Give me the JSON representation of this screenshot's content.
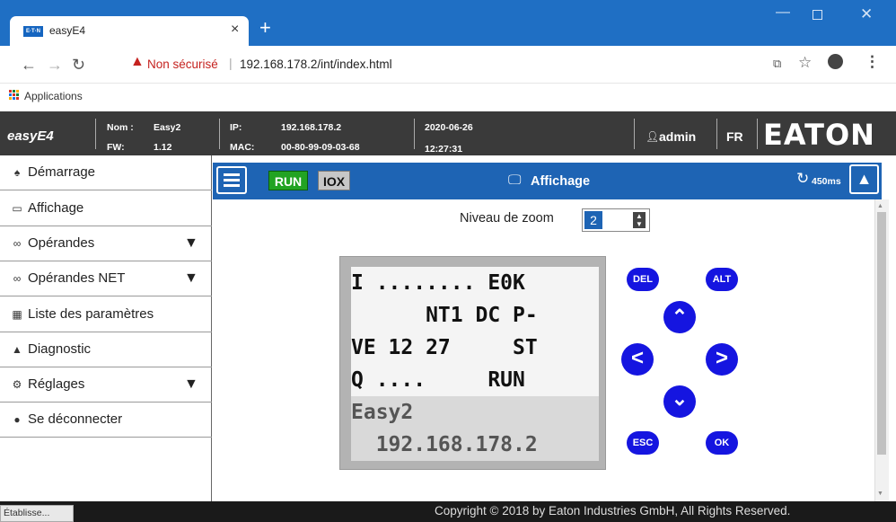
{
  "browser": {
    "tab_title": "easyE4",
    "tab_favicon_text": "E·T·N",
    "tab_close": "×",
    "new_tab": "+",
    "security_label": "Non sécurisé",
    "url": "192.168.178.2/int/index.html",
    "bookmark_apps": "Applications",
    "status_text": "Établisse..."
  },
  "header": {
    "product": "easyE4",
    "name_label": "Nom :",
    "name_value": "Easy2",
    "fw_label": "FW:",
    "fw_value": "1.12",
    "ip_label": "IP:",
    "ip_value": "192.168.178.2",
    "mac_label": "MAC:",
    "mac_value": "00-80-99-09-03-68",
    "date": "2020-06-26",
    "time": "12:27:31",
    "user": "admin",
    "lang": "FR",
    "brand": "EATON"
  },
  "sidebar": {
    "items": [
      {
        "label": "Démarrage",
        "icon": "home-icon",
        "expandable": false
      },
      {
        "label": "Affichage",
        "icon": "monitor-icon",
        "expandable": false
      },
      {
        "label": "Opérandes",
        "icon": "link-icon",
        "expandable": true
      },
      {
        "label": "Opérandes NET",
        "icon": "link-icon",
        "expandable": true
      },
      {
        "label": "Liste des paramètres",
        "icon": "list-icon",
        "expandable": false
      },
      {
        "label": "Diagnostic",
        "icon": "warning-icon",
        "expandable": false
      },
      {
        "label": "Réglages",
        "icon": "gear-icon",
        "expandable": true
      },
      {
        "label": "Se déconnecter",
        "icon": "user-icon",
        "expandable": false
      }
    ]
  },
  "toolbar": {
    "run_label": "RUN",
    "iox_label": "IOX",
    "title": "Affichage",
    "refresh_label": "450ms"
  },
  "zoom": {
    "label": "Niveau de zoom",
    "value": "2"
  },
  "lcd": {
    "row1": "I ........ E0K",
    "row2": "      NT1 DC P-",
    "row3": "VE 12 27     ST",
    "row4": "Q ....     RUN",
    "row5": "Easy2",
    "row6": "  192.168.178.2"
  },
  "keys": {
    "del": "DEL",
    "alt": "ALT",
    "esc": "ESC",
    "ok": "OK"
  },
  "footer": {
    "copyright": "Copyright © 2018 by Eaton Industries GmbH, All Rights Reserved."
  },
  "colors": {
    "browser_blue": "#1f6fc4",
    "header_dark": "#3a3a3a",
    "toolbar_blue": "#1e64b4",
    "run_green": "#22a322",
    "key_blue": "#1515e0"
  }
}
